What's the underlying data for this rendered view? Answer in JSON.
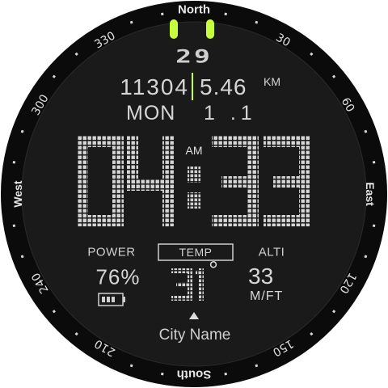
{
  "watch": {
    "bezel": {
      "north": "North",
      "east": "East",
      "south": "South",
      "west": "West",
      "degrees": [
        "30",
        "60",
        "120",
        "150",
        "210",
        "240",
        "300",
        "330"
      ]
    },
    "day_of_month": "29",
    "steps": "11304",
    "distance": "5.46",
    "distance_unit": "KM",
    "weekday": "MON",
    "date_small": "1 .1",
    "time": {
      "hours": "04",
      "minutes": "33",
      "ampm": "AM"
    },
    "power": {
      "label": "POWER",
      "value": "76%",
      "level": 0.76
    },
    "temp": {
      "label": "TEMP",
      "value": "31",
      "unit": "°"
    },
    "alti": {
      "label": "ALTI",
      "value": "33",
      "unit": "M/FT"
    },
    "city": "City Name",
    "icons": [
      "battery-icon",
      "up-triangle-icon"
    ],
    "colors": {
      "accent": "#c8ff3c",
      "text": "#d9d9d9",
      "bezel": "#0b0b0b",
      "dial": "#1a1a1a"
    }
  }
}
